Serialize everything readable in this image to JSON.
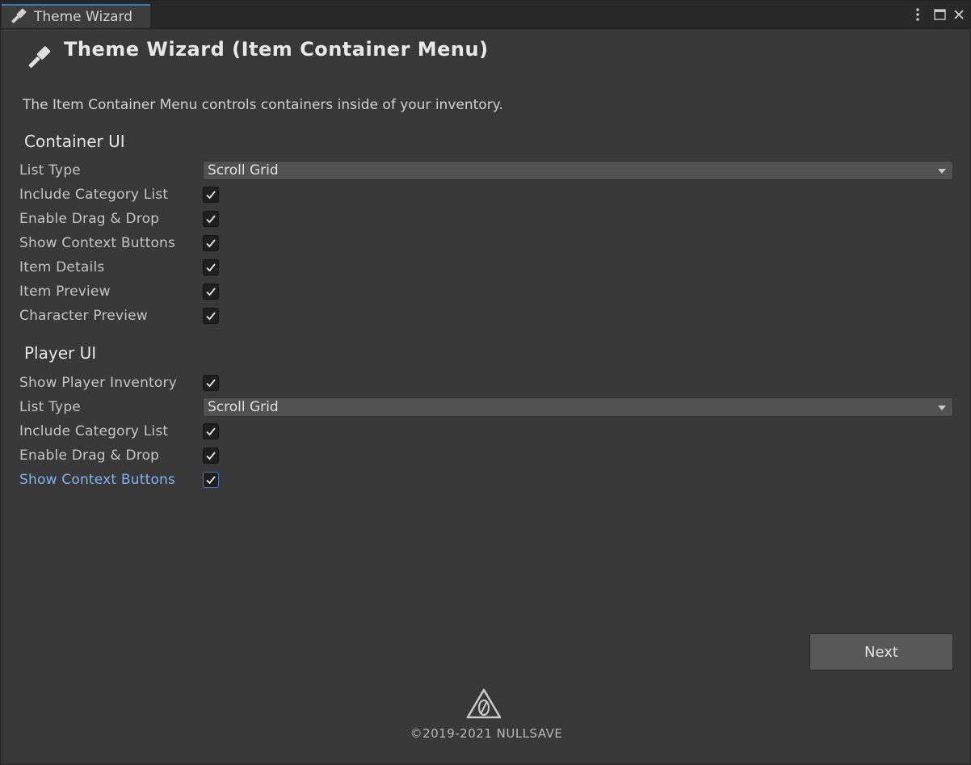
{
  "tab": {
    "title": "Theme Wizard"
  },
  "header": {
    "title": "Theme Wizard (Item Container Menu)",
    "description": "The Item Container Menu controls containers inside of your inventory."
  },
  "container_ui": {
    "heading": "Container UI",
    "list_type_label": "List Type",
    "list_type_value": "Scroll Grid",
    "options": [
      {
        "label": "Include Category List",
        "checked": true
      },
      {
        "label": "Enable Drag & Drop",
        "checked": true
      },
      {
        "label": "Show Context Buttons",
        "checked": true
      },
      {
        "label": "Item Details",
        "checked": true
      },
      {
        "label": "Item Preview",
        "checked": true
      },
      {
        "label": "Character Preview",
        "checked": true
      }
    ]
  },
  "player_ui": {
    "heading": "Player UI",
    "show_inventory_label": "Show Player Inventory",
    "list_type_label": "List Type",
    "list_type_value": "Scroll Grid",
    "options": [
      {
        "label": "Include Category List",
        "checked": true
      },
      {
        "label": "Enable Drag & Drop",
        "checked": true
      },
      {
        "label": "Show Context Buttons",
        "checked": true,
        "focused": true
      }
    ]
  },
  "footer": {
    "next_label": "Next",
    "copyright": "©2019-2021 NULLSAVE"
  },
  "colors": {
    "background": "#383838",
    "accent": "#3a79bb",
    "focused_label": "#7fb2ee"
  }
}
